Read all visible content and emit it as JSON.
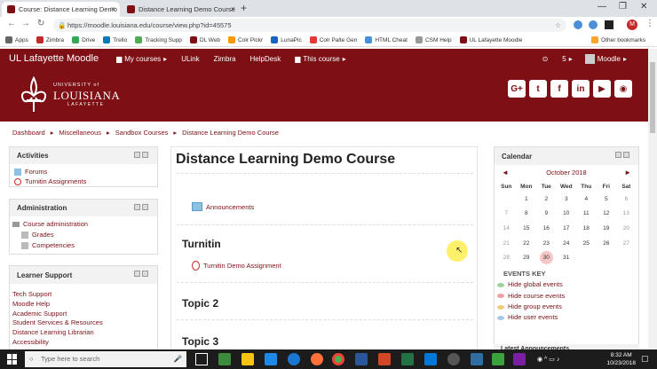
{
  "browser": {
    "tabs": [
      {
        "title": "Course: Distance Learning Demo",
        "active": true
      },
      {
        "title": "Distance Learning Demo Course",
        "active": false
      }
    ],
    "url": "https://moodle.louisiana.edu/course/view.php?id=45575",
    "bookmarks": [
      "Apps",
      "Zimbra",
      "Drive",
      "Trello",
      "Tracking Supp",
      "DL Web",
      "Colr Pickr",
      "LunaPic",
      "Colr Palte Gen",
      "HTML Cheat",
      "CSM Help",
      "UL Lafayette Moodle"
    ],
    "other_bookmarks": "Other bookmarks"
  },
  "navbar": {
    "brand": "UL Lafayette Moodle",
    "items": [
      "My courses",
      "ULink",
      "Zimbra",
      "HelpDesk",
      "This course"
    ],
    "notif_count": "5",
    "user": "Moodle"
  },
  "header": {
    "logo_line1": "UNIVERSITY of",
    "logo_line2": "LOUISIANA",
    "logo_line3": "LAFAYETTE",
    "social": [
      "G+",
      "t",
      "f",
      "in",
      "yt",
      "globe"
    ]
  },
  "breadcrumb": [
    "Dashboard",
    "Miscellaneous",
    "Sandbox Courses",
    "Distance Learning Demo Course"
  ],
  "activities": {
    "title": "Activities",
    "items": [
      "Forums",
      "Turnitin Assignments"
    ]
  },
  "administration": {
    "title": "Administration",
    "root": "Course administration",
    "items": [
      "Grades",
      "Competencies"
    ]
  },
  "learner_support": {
    "title": "Learner Support",
    "items": [
      "Tech Support",
      "Moodle Help",
      "Academic Support",
      "Student Services & Resources",
      "Distance Learning Librarian",
      "Accessibility"
    ]
  },
  "course": {
    "title": "Distance Learning Demo Course",
    "announcements": "Announcements",
    "sections": [
      {
        "name": "Turnitin",
        "activity": "Turnitin Demo Assignment"
      },
      {
        "name": "Topic 2"
      },
      {
        "name": "Topic 3"
      }
    ]
  },
  "calendar": {
    "title": "Calendar",
    "month": "October 2018",
    "prev": "◄",
    "next": "►",
    "days": [
      "Sun",
      "Mon",
      "Tue",
      "Wed",
      "Thu",
      "Fri",
      "Sat"
    ],
    "weeks": [
      [
        "",
        "1",
        "2",
        "3",
        "4",
        "5",
        "6"
      ],
      [
        "7",
        "8",
        "9",
        "10",
        "11",
        "12",
        "13"
      ],
      [
        "14",
        "15",
        "16",
        "17",
        "18",
        "19",
        "20"
      ],
      [
        "21",
        "22",
        "23",
        "24",
        "25",
        "26",
        "27"
      ],
      [
        "28",
        "29",
        "30",
        "31",
        "",
        "",
        ""
      ]
    ],
    "today": "30",
    "events_key": "EVENTS KEY",
    "events": [
      {
        "label": "Hide global events",
        "color": "#9bd49b"
      },
      {
        "label": "Hide course events",
        "color": "#f0a0a0"
      },
      {
        "label": "Hide group events",
        "color": "#f5c97a"
      },
      {
        "label": "Hide user events",
        "color": "#a8c8e8"
      }
    ],
    "next_block": "Latest Announcements"
  },
  "taskbar": {
    "search_placeholder": "Type here to search",
    "time": "8:32 AM",
    "date": "10/23/2018"
  },
  "colors": {
    "brand": "#7d0f15",
    "link": "#7d0f15"
  }
}
